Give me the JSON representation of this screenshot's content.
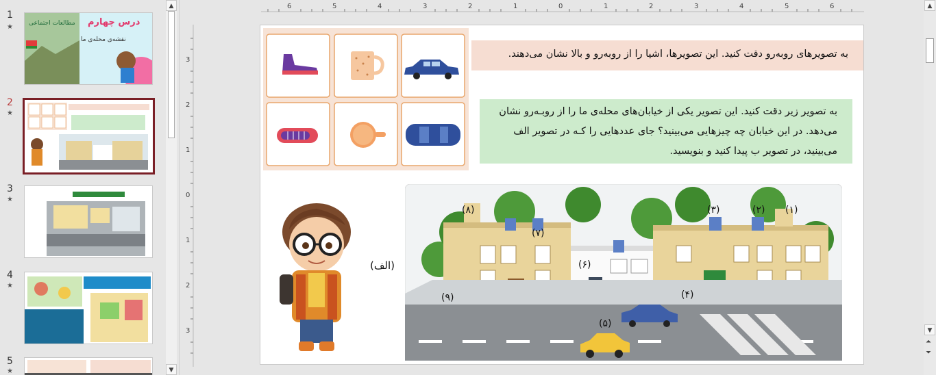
{
  "thumbnails": [
    {
      "number": "1",
      "star": "★",
      "title": "درس چهارم",
      "subtitle": "نقشه‌ی محله‌ی ما",
      "book": "مطالعات اجتماعی"
    },
    {
      "number": "2",
      "star": "★"
    },
    {
      "number": "3",
      "star": "★"
    },
    {
      "number": "4",
      "star": "★"
    },
    {
      "number": "5",
      "star": "★"
    }
  ],
  "ruler": {
    "horizontal": [
      "6",
      "5",
      "4",
      "3",
      "2",
      "1",
      "0",
      "1",
      "2",
      "3",
      "4",
      "5",
      "6"
    ],
    "vertical": [
      "3",
      "2",
      "1",
      "0",
      "1",
      "2",
      "3"
    ]
  },
  "slide": {
    "instruction_1": "به تصویرهای روبه‌رو دقت کنید. این تصویرها، اشیا را از روبه‌رو و بالا نشان می‌دهند.",
    "instruction_2": "به تصویر زیر دقت کنید. این تصویر یکی از خیابان‌های محله‌ی ما را از روبـه‌رو نشان می‌دهد. در این خیابان چه چیزهایی می‌بینید؟ جای عددهایی را کـه در تصویر الف می‌بینید، در تصویر ب پیدا کنید و بنویسید.",
    "label_alef": "(الف)",
    "street_labels": {
      "l1": "(۱)",
      "l2": "(۲)",
      "l3": "(۳)",
      "l4": "(۴)",
      "l5": "(۵)",
      "l6": "(۶)",
      "l7": "(۷)",
      "l8": "(۸)",
      "l9": "(۹)"
    }
  },
  "colors": {
    "selected_thumb_border": "#7a1f26",
    "para1_bg": "#f6ddd2",
    "para2_bg": "#cdebcc",
    "card_border": "#e9a66b"
  }
}
